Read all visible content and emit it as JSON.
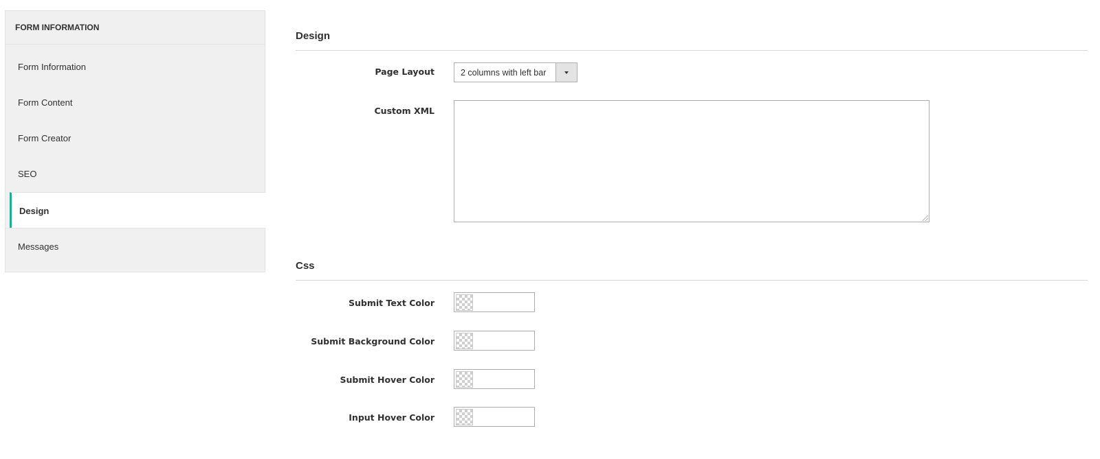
{
  "sidebar": {
    "title": "FORM INFORMATION",
    "items": [
      {
        "label": "Form Information"
      },
      {
        "label": "Form Content"
      },
      {
        "label": "Form Creator"
      },
      {
        "label": "SEO"
      },
      {
        "label": "Design",
        "active": true
      },
      {
        "label": "Messages"
      }
    ],
    "accent_color": "#1fae8f"
  },
  "design": {
    "title": "Design",
    "page_layout": {
      "label": "Page Layout",
      "value": "2 columns with left bar"
    },
    "custom_xml": {
      "label": "Custom XML",
      "value": ""
    }
  },
  "css": {
    "title": "Css",
    "fields": [
      {
        "label": "Submit Text Color",
        "value": ""
      },
      {
        "label": "Submit Background Color",
        "value": ""
      },
      {
        "label": "Submit Hover Color",
        "value": ""
      },
      {
        "label": "Input Hover Color",
        "value": ""
      }
    ]
  }
}
